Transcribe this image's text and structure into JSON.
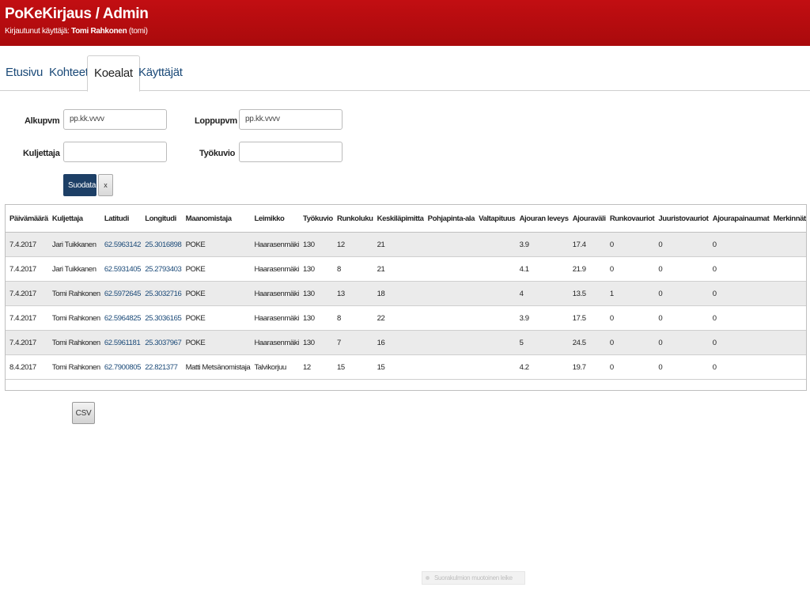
{
  "header": {
    "title": "PoKeKirjaus / Admin",
    "logged_in_label": "Kirjautunut käyttäjä:",
    "user_name": "Tomi Rahkonen",
    "user_login": "(tomi)"
  },
  "tabs": [
    {
      "label": "Etusivu"
    },
    {
      "label": "Kohteet"
    },
    {
      "label": "Koealat",
      "active": true
    },
    {
      "label": "Käyttäjät"
    }
  ],
  "filters": {
    "start_label": "Alkupvm",
    "start_placeholder": "pp.kk.vvvv",
    "end_label": "Loppupvm",
    "end_placeholder": "pp.kk.vvvv",
    "driver_label": "Kuljettaja",
    "driver_value": "",
    "workpattern_label": "Työkuvio",
    "workpattern_value": "",
    "filter_button": "Suodata",
    "clear_button": "x"
  },
  "table": {
    "columns": [
      "Päivämäärä",
      "Kuljettaja",
      "Latitudi",
      "Longitudi",
      "Maanomistaja",
      "Leimikko",
      "Työkuvio",
      "Runkoluku",
      "Keskiläpimitta",
      "Pohjapinta-ala",
      "Valtapituus",
      "Ajouran leveys",
      "Ajouraväli",
      "Runkovauriot",
      "Juuristovauriot",
      "Ajourapainaumat",
      "Merkinnät"
    ],
    "rows": [
      [
        "7.4.2017",
        "Jari Tuikkanen",
        "62.5963142",
        "25.3016898",
        "POKE",
        "Haarasenmäki",
        "130",
        "12",
        "21",
        "",
        "",
        "3.9",
        "17.4",
        "0",
        "0",
        "0",
        ""
      ],
      [
        "7.4.2017",
        "Jari Tuikkanen",
        "62.5931405",
        "25.2793403",
        "POKE",
        "Haarasenmäki",
        "130",
        "8",
        "21",
        "",
        "",
        "4.1",
        "21.9",
        "0",
        "0",
        "0",
        ""
      ],
      [
        "7.4.2017",
        "Tomi Rahkonen",
        "62.5972645",
        "25.3032716",
        "POKE",
        "Haarasenmäki",
        "130",
        "13",
        "18",
        "",
        "",
        "4",
        "13.5",
        "1",
        "0",
        "0",
        ""
      ],
      [
        "7.4.2017",
        "Tomi Rahkonen",
        "62.5964825",
        "25.3036165",
        "POKE",
        "Haarasenmäki",
        "130",
        "8",
        "22",
        "",
        "",
        "3.9",
        "17.5",
        "0",
        "0",
        "0",
        ""
      ],
      [
        "7.4.2017",
        "Tomi Rahkonen",
        "62.5961181",
        "25.3037967",
        "POKE",
        "Haarasenmäki",
        "130",
        "7",
        "16",
        "",
        "",
        "5",
        "24.5",
        "0",
        "0",
        "0",
        ""
      ],
      [
        "8.4.2017",
        "Tomi Rahkonen",
        "62.7900805",
        "22.821377",
        "Matti Metsänomistaja",
        "Talvikorjuu",
        "12",
        "15",
        "15",
        "",
        "",
        "4.2",
        "19.7",
        "0",
        "0",
        "0",
        ""
      ]
    ]
  },
  "csv_button": "CSV",
  "faint_overlay": "Suorakulmion muotoinen leike",
  "colors": {
    "header_red": "#b50c0f",
    "link_blue": "#1b4a78",
    "button_navy": "#1d3f66",
    "row_stripe": "#ebebeb"
  }
}
